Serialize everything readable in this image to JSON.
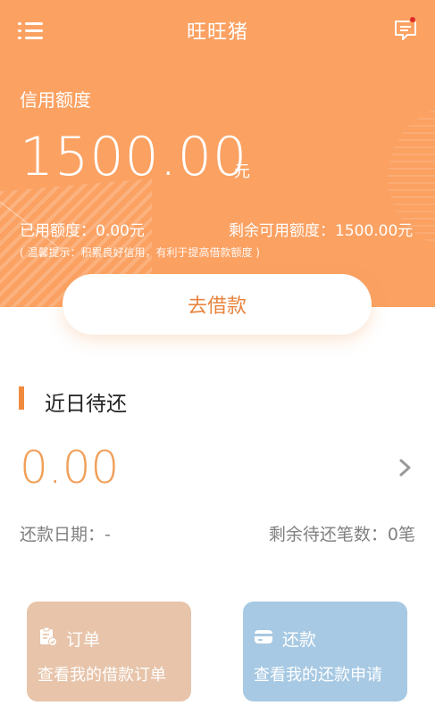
{
  "header": {
    "title": "旺旺猪",
    "menu_icon": "menu-list-icon",
    "message_icon": "message-icon",
    "has_unread": true
  },
  "credit": {
    "label": "信用额度",
    "amount": "1500.00",
    "unit": "元",
    "used": "已用额度：0.00元",
    "remaining": "剩余可用额度：1500.00元",
    "tip": "( 温馨提示：积累良好信用，有利于提高借款额度 )"
  },
  "borrow_button": {
    "label": "去借款"
  },
  "due": {
    "section_title": "近日待还",
    "amount": "0.00",
    "date": "还款日期：-",
    "remaining_count": "剩余待还笔数：0笔"
  },
  "cards": [
    {
      "title": "订单",
      "subtitle": "查看我的借款订单",
      "icon": "clipboard-check-icon"
    },
    {
      "title": "还款",
      "subtitle": "查看我的还款申请",
      "icon": "wallet-card-icon"
    }
  ],
  "colors": {
    "hero": "#fba162",
    "accent": "#f08a3e",
    "orders_card": "#e7c4aa",
    "repay_card": "#a7c9e3"
  }
}
